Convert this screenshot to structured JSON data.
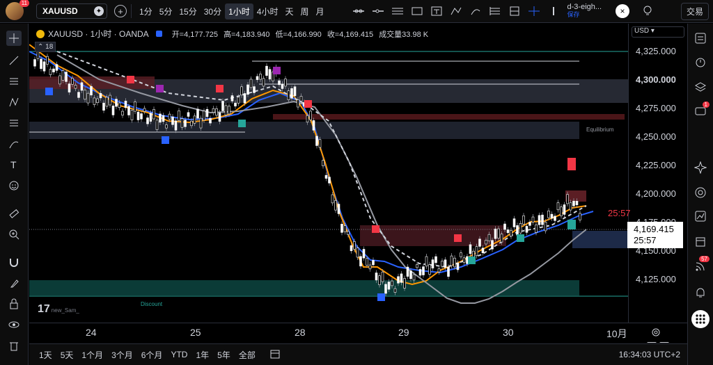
{
  "toolbar": {
    "avatar_badge": "11",
    "symbol": "XAUUSD",
    "timeframes": [
      "1分",
      "5分",
      "15分",
      "30分",
      "1小时",
      "4小时",
      "天",
      "周",
      "月"
    ],
    "active_timeframe": "1小时",
    "script_name": "d-3-eigh...",
    "script_save": "保存",
    "trade_label": "交易"
  },
  "legend": {
    "title": "XAUUSD · 1小时 · OANDA",
    "open": "开=4,177.725",
    "high": "高=4,183.940",
    "low": "低=4,166.990",
    "close": "收=4,169.415",
    "volume": "成交量33.98 K",
    "indicator_count": "18"
  },
  "price_axis": {
    "currency": "USD",
    "labels": [
      "4,325.000",
      "4,300.000",
      "4,275.000",
      "4,250.000",
      "4,225.000",
      "4,200.000",
      "4,175.000",
      "4,150.000",
      "4,125.000"
    ],
    "current_price": "4,169.415",
    "countdown": "25:57",
    "countdown_red": "25:57"
  },
  "time_axis": {
    "labels": [
      "24",
      "25",
      "28",
      "29",
      "30",
      "10月"
    ]
  },
  "chart_annotations": {
    "equilibrium": "Equilibrium",
    "discount": "Discount",
    "watermark_user": "new_Sam_"
  },
  "bottom": {
    "ranges": [
      "1天",
      "5天",
      "1个月",
      "3个月",
      "6个月",
      "YTD",
      "1年",
      "5年",
      "全部"
    ],
    "clock": "16:34:03 UTC+2"
  },
  "right_badges": {
    "chat": "1",
    "alerts": "57"
  },
  "colors": {
    "bull": "#ffffff",
    "bear": "#ffffff",
    "ema_fast": "#2962ff",
    "ema_mid": "#ff9800",
    "ema_slow": "#9598a1",
    "up_zone": "#26a69a",
    "down_zone": "#f23645"
  }
}
